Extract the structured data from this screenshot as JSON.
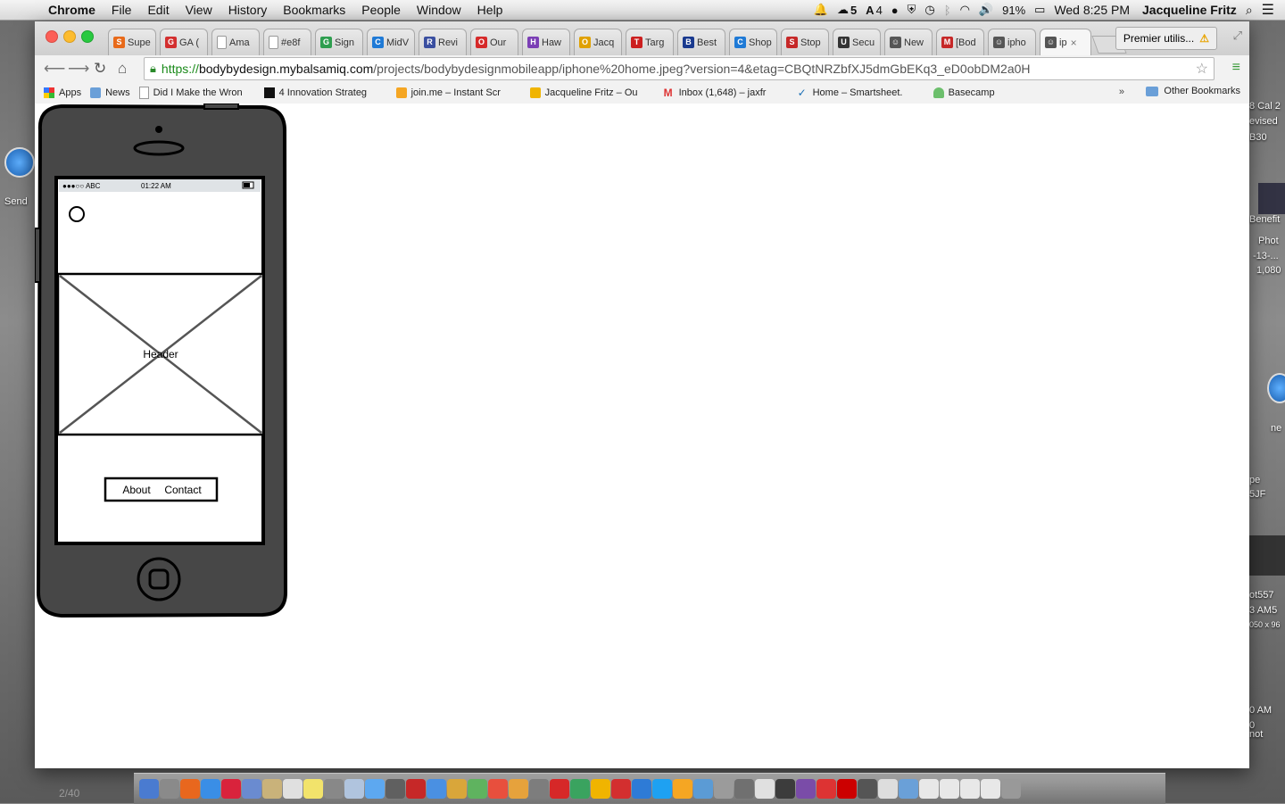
{
  "menubar": {
    "app": "Chrome",
    "items": [
      "File",
      "Edit",
      "View",
      "History",
      "Bookmarks",
      "People",
      "Window",
      "Help"
    ],
    "status": {
      "count_a": "5",
      "count_b": "4",
      "battery": "91%",
      "clock": "Wed 8:25 PM",
      "user": "Jacqueline Fritz"
    }
  },
  "browser": {
    "tabs": [
      {
        "label": "Supe",
        "color": "#e86a1a",
        "glyph": "S"
      },
      {
        "label": "GA (",
        "color": "#d32f2f",
        "glyph": "G"
      },
      {
        "label": "Ama",
        "color": "#ffffff",
        "glyph": ""
      },
      {
        "label": "#e8f",
        "color": "#ffffff",
        "glyph": ""
      },
      {
        "label": "Sign",
        "color": "#2e9e4f",
        "glyph": "G"
      },
      {
        "label": "MidV",
        "color": "#1f7ad6",
        "glyph": "C"
      },
      {
        "label": "Revi",
        "color": "#3a4fa0",
        "glyph": "R"
      },
      {
        "label": "Our",
        "color": "#d62a2a",
        "glyph": "O"
      },
      {
        "label": "Haw",
        "color": "#7b3fb5",
        "glyph": "H"
      },
      {
        "label": "Jacq",
        "color": "#e0a100",
        "glyph": "O"
      },
      {
        "label": "Targ",
        "color": "#cc1f1f",
        "glyph": "T"
      },
      {
        "label": "Best",
        "color": "#1a3a8f",
        "glyph": "B"
      },
      {
        "label": "Shop",
        "color": "#1f7ad6",
        "glyph": "C"
      },
      {
        "label": "Stop",
        "color": "#c62828",
        "glyph": "S"
      },
      {
        "label": "Secu",
        "color": "#333333",
        "glyph": "U"
      },
      {
        "label": "New",
        "color": "#555555",
        "glyph": "☺"
      },
      {
        "label": "[Bod",
        "color": "#c62828",
        "glyph": "M"
      },
      {
        "label": "ipho",
        "color": "#555555",
        "glyph": "☺"
      },
      {
        "label": "ip",
        "color": "#555555",
        "glyph": "☺",
        "active": true
      }
    ],
    "profile_label": "Premier utilis...",
    "url": {
      "scheme": "https://",
      "domain": "bodybydesign.mybalsamiq.com",
      "path": "/projects/bodybydesignmobileapp/iphone%20home.jpeg?version=4&etag=CBQtNRZbfXJ5dmGbEKq3_eD0obDM2a0H"
    },
    "bookmarks": [
      {
        "label": "Apps",
        "icon": "apps-grid"
      },
      {
        "label": "News",
        "icon": "folder"
      },
      {
        "label": "Did I Make the Wron",
        "icon": "page"
      },
      {
        "label": "4 Innovation Strateg",
        "icon": "black-square"
      },
      {
        "label": "join.me – Instant Scr",
        "icon": "joinme"
      },
      {
        "label": "Jacqueline Fritz – Ou",
        "icon": "outlook"
      },
      {
        "label": "Inbox (1,648) – jaxfr",
        "icon": "gmail"
      },
      {
        "label": "Home – Smartsheet.",
        "icon": "check"
      },
      {
        "label": "Basecamp",
        "icon": "basecamp"
      }
    ],
    "bookmarks_more": "»",
    "other_bookmarks": "Other Bookmarks"
  },
  "mockup": {
    "status_bar": {
      "carrier": "●●●○○ ABC",
      "time": "01:22 AM"
    },
    "image_placeholder_label": "Header",
    "nav_buttons": [
      "About",
      "Contact"
    ]
  },
  "desktop": {
    "left_label": "Send",
    "right_labels": [
      "8 Cal 2",
      "evised",
      "B30",
      "Benefit",
      "Phot",
      "-13-...",
      "1,080",
      "ne",
      "pe",
      "5JF",
      "ot557",
      "3 AM5",
      "050 x 96",
      "0",
      "not",
      "0 AM"
    ]
  },
  "dock_page": "2/40"
}
